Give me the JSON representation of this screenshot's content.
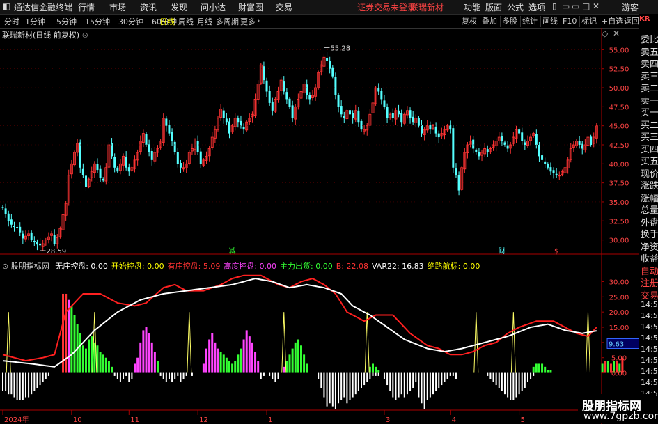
{
  "titlebar": {
    "app_name": "通达信金融终端",
    "menus": [
      "行情",
      "市场",
      "资讯",
      "发现",
      "问小达",
      "财富圈",
      "交易"
    ],
    "notice": "证券交易未登录",
    "stock": "联瑞新材",
    "right_menus": [
      "功能",
      "版面",
      "公式",
      "选项"
    ],
    "user": "游客"
  },
  "toolbar": {
    "periods": [
      "分时",
      "1分钟",
      "5分钟",
      "15分钟",
      "30分钟",
      "60分钟",
      "日线",
      "周线",
      "月线",
      "多周期",
      "更多"
    ],
    "active": "日线",
    "right_buttons": [
      "复权",
      "叠加",
      "多股",
      "统计",
      "画线",
      "F10",
      "标记",
      "+自选",
      "返回"
    ]
  },
  "chart_header": {
    "title": "联瑞新材(日线 前复权)"
  },
  "indicator_header": {
    "name": "股朋指标网",
    "items": [
      {
        "label": "无庄控盘:",
        "value": "0.00",
        "color": "#ffffff"
      },
      {
        "label": "开始控盘:",
        "value": "0.00",
        "color": "#ffff00"
      },
      {
        "label": "有庄控盘:",
        "value": "5.09",
        "color": "#ff3333"
      },
      {
        "label": "高度控盘:",
        "value": "0.00",
        "color": "#ff44ff"
      },
      {
        "label": "主力出货:",
        "value": "0.00",
        "color": "#33ff33"
      },
      {
        "label": "B:",
        "value": "22.08",
        "color": "#ff3333"
      },
      {
        "label": "VAR22:",
        "value": "16.83",
        "color": "#ffffff"
      },
      {
        "label": "绝路航标:",
        "value": "0.00",
        "color": "#ffff00"
      }
    ]
  },
  "chart_data": [
    {
      "type": "candlestick",
      "price_axis_ticks": [
        "55.00",
        "52.50",
        "50.00",
        "47.50",
        "45.00",
        "42.50",
        "40.00",
        "37.50",
        "35.00",
        "32.50",
        "30.00"
      ],
      "ylim": [
        28.5,
        56.5
      ],
      "annotations": {
        "high": "55.28",
        "low": "28.59"
      },
      "event_markers": [
        "减",
        "财",
        "$"
      ],
      "close": [
        34.2,
        33.4,
        32.5,
        32.0,
        31.7,
        31.6,
        31.0,
        30.2,
        30.5,
        30.8,
        30.0,
        29.7,
        29.4,
        29.3,
        29.5,
        30.0,
        30.4,
        30.8,
        29.5,
        30.3,
        31.5,
        33.3,
        34.8,
        38.5,
        40.0,
        41.5,
        42.7,
        39.5,
        38.5,
        37.0,
        38.0,
        39.0,
        40.0,
        39.2,
        38.2,
        37.8,
        39.5,
        42.5,
        41.0,
        39.5,
        39.0,
        40.0,
        41.0,
        39.5,
        39.0,
        39.5,
        40.5,
        41.5,
        43.0,
        44.0,
        42.5,
        41.5,
        40.5,
        41.5,
        42.0,
        43.0,
        46.0,
        45.0,
        44.0,
        43.0,
        41.5,
        40.0,
        39.5,
        39.5,
        40.0,
        41.5,
        42.0,
        43.0,
        41.5,
        40.0,
        40.5,
        41.0,
        42.0,
        43.5,
        44.5,
        46.0,
        47.2,
        46.0,
        45.5,
        44.0,
        45.0,
        46.0,
        45.5,
        45.0,
        44.5,
        45.5,
        46.0,
        46.5,
        48.5,
        50.5,
        53.0,
        51.0,
        49.5,
        48.0,
        47.0,
        48.5,
        49.5,
        51.0,
        49.5,
        48.5,
        47.5,
        46.0,
        47.5,
        48.5,
        49.5,
        50.5,
        49.0,
        48.5,
        49.0,
        50.0,
        52.0,
        53.0,
        54.0,
        53.5,
        52.5,
        51.5,
        49.0,
        47.5,
        46.5,
        46.0,
        47.0,
        46.5,
        46.0,
        47.0,
        45.5,
        44.5,
        44.5,
        45.0,
        46.5,
        48.0,
        50.0,
        49.5,
        48.5,
        47.5,
        46.0,
        46.5,
        46.0,
        47.0,
        46.5,
        45.5,
        46.5,
        47.0,
        46.0,
        45.5,
        46.0,
        45.0,
        44.0,
        44.5,
        45.0,
        44.5,
        45.0,
        44.0,
        43.5,
        44.0,
        44.5,
        45.0,
        44.5,
        39.5,
        38.5,
        36.5,
        39.5,
        41.5,
        42.5,
        43.0,
        42.0,
        41.5,
        41.0,
        41.5,
        42.0,
        41.5,
        42.0,
        42.5,
        43.0,
        43.5,
        43.0,
        42.5,
        42.0,
        42.5,
        43.5,
        44.5,
        44.0,
        43.0,
        42.5,
        43.0,
        43.5,
        44.0,
        42.5,
        41.0,
        40.5,
        40.0,
        39.5,
        39.0,
        38.8,
        38.5,
        38.5,
        39.0,
        39.5,
        40.5,
        42.0,
        42.5,
        43.0,
        42.5,
        42.0,
        42.5,
        43.5,
        42.5,
        43.5,
        45.0
      ]
    },
    {
      "type": "line",
      "indicator_axis_ticks": [
        "30.00",
        "25.00",
        "20.00",
        "15.00",
        "10.00",
        "5.00",
        "0.00"
      ],
      "ylim": [
        -12,
        34
      ],
      "current_value": "9.63",
      "series": [
        {
          "color": "#ff2020",
          "keys": [
            [
              0,
              6
            ],
            [
              8,
              4
            ],
            [
              14,
              5
            ],
            [
              18,
              6
            ],
            [
              22,
              20
            ],
            [
              28,
              26
            ],
            [
              34,
              26
            ],
            [
              40,
              23
            ],
            [
              46,
              22
            ],
            [
              50,
              23
            ],
            [
              56,
              28
            ],
            [
              60,
              29
            ],
            [
              64,
              27
            ],
            [
              70,
              27
            ],
            [
              76,
              29
            ],
            [
              80,
              31
            ],
            [
              84,
              32
            ],
            [
              90,
              32
            ],
            [
              96,
              29
            ],
            [
              100,
              28
            ],
            [
              104,
              30
            ],
            [
              108,
              31
            ],
            [
              112,
              29
            ],
            [
              116,
              26
            ],
            [
              120,
              20
            ],
            [
              126,
              17
            ],
            [
              130,
              19
            ],
            [
              136,
              19
            ],
            [
              142,
              13
            ],
            [
              148,
              9
            ],
            [
              152,
              8
            ],
            [
              156,
              6
            ],
            [
              160,
              6
            ],
            [
              164,
              7
            ],
            [
              168,
              9
            ],
            [
              172,
              10
            ],
            [
              176,
              13
            ],
            [
              180,
              15
            ],
            [
              186,
              17
            ],
            [
              192,
              17
            ],
            [
              196,
              15
            ],
            [
              200,
              13
            ],
            [
              204,
              12
            ],
            [
              208,
              16
            ],
            [
              212,
              19
            ],
            [
              216,
              22
            ]
          ]
        },
        {
          "color": "#ffffff",
          "keys": [
            [
              0,
              4
            ],
            [
              10,
              3
            ],
            [
              18,
              2
            ],
            [
              24,
              6
            ],
            [
              32,
              14
            ],
            [
              40,
              20
            ],
            [
              48,
              24
            ],
            [
              56,
              26
            ],
            [
              64,
              27
            ],
            [
              72,
              28
            ],
            [
              80,
              29
            ],
            [
              88,
              31
            ],
            [
              94,
              30
            ],
            [
              100,
              28
            ],
            [
              106,
              29
            ],
            [
              112,
              28
            ],
            [
              118,
              26
            ],
            [
              122,
              22
            ],
            [
              128,
              19
            ],
            [
              134,
              15
            ],
            [
              140,
              11
            ],
            [
              148,
              8
            ],
            [
              154,
              7
            ],
            [
              160,
              8
            ],
            [
              168,
              10
            ],
            [
              176,
              12
            ],
            [
              184,
              15
            ],
            [
              190,
              16
            ],
            [
              196,
              14
            ],
            [
              202,
              13
            ],
            [
              208,
              14
            ],
            [
              214,
              16
            ],
            [
              218,
              17
            ]
          ]
        }
      ],
      "histogram_pos": [
        0,
        0,
        0,
        0,
        0,
        0,
        0,
        0,
        0,
        0,
        0,
        0,
        0,
        0,
        0,
        0,
        0,
        0,
        0,
        0,
        0,
        26,
        26,
        24,
        22,
        19,
        16,
        13,
        9,
        8,
        11,
        12,
        10,
        9,
        7,
        6,
        5,
        4,
        2,
        0,
        0,
        0,
        0,
        0,
        0,
        0,
        3,
        5,
        10,
        14,
        15,
        13,
        10,
        7,
        4,
        0,
        0,
        0,
        0,
        0,
        0,
        0,
        0,
        0,
        0,
        0,
        0,
        0,
        0,
        0,
        3,
        8,
        11,
        13,
        10,
        8,
        7,
        6,
        5,
        4,
        3,
        4,
        6,
        8,
        11,
        14,
        12,
        10,
        7,
        4,
        0,
        0,
        0,
        0,
        0,
        0,
        0,
        0,
        2,
        4,
        6,
        8,
        10,
        11,
        9,
        6,
        3,
        0,
        0,
        0,
        0,
        0,
        0,
        0,
        0,
        0,
        0,
        0,
        0,
        0,
        0,
        0,
        0,
        0,
        0,
        0,
        0,
        0,
        2,
        3,
        2,
        1,
        0,
        0,
        0,
        0,
        0,
        0,
        0,
        0,
        0,
        0,
        0,
        0,
        0,
        0,
        0,
        0,
        0,
        0,
        0,
        0,
        0,
        0,
        0,
        0,
        0,
        0,
        0,
        0,
        0,
        0,
        0,
        0,
        0,
        0,
        0,
        0,
        0,
        0,
        0,
        0,
        0,
        0,
        0,
        0,
        0,
        0,
        0,
        0,
        0,
        0,
        0,
        0,
        0,
        2,
        3,
        3,
        3,
        2,
        1,
        1,
        0,
        0,
        0,
        0,
        0,
        0,
        0,
        0,
        0,
        0,
        0,
        0,
        0,
        0,
        0,
        0,
        0,
        3,
        4,
        4,
        3,
        4,
        4,
        3,
        5
      ],
      "histogram_neg": [
        -6,
        -6,
        -7,
        -7,
        -8,
        -9,
        -9,
        -9,
        -8,
        -8,
        -7,
        -6,
        -5,
        -4,
        -3,
        -2,
        -1,
        0,
        0,
        0,
        0,
        0,
        0,
        0,
        0,
        0,
        0,
        0,
        0,
        0,
        0,
        0,
        0,
        0,
        0,
        0,
        0,
        0,
        0,
        -1,
        -2,
        -3,
        -2,
        -1,
        -3,
        -2,
        0,
        0,
        0,
        0,
        0,
        0,
        0,
        0,
        0,
        -1,
        -2,
        -3,
        -2,
        -3,
        -2,
        -1,
        -3,
        -2,
        -1,
        0,
        -1,
        0,
        0,
        0,
        0,
        0,
        0,
        0,
        0,
        0,
        0,
        0,
        0,
        0,
        0,
        0,
        0,
        0,
        0,
        0,
        0,
        0,
        0,
        0,
        -2,
        -1,
        0,
        -1,
        -2,
        -3,
        -2,
        0,
        0,
        0,
        0,
        0,
        0,
        0,
        0,
        0,
        0,
        0,
        0,
        0,
        -2,
        -5,
        -8,
        -11,
        -10,
        -11,
        -12,
        -10,
        -9,
        -8,
        -10,
        -9,
        -8,
        -7,
        -6,
        -5,
        -4,
        -3,
        -2,
        -1,
        -1,
        -1,
        0,
        -2,
        -4,
        -6,
        -8,
        -9,
        -8,
        -7,
        -8,
        -7,
        -6,
        -5,
        -3,
        -8,
        -10,
        -12,
        -9,
        -8,
        -7,
        -6,
        -5,
        -4,
        -3,
        -2,
        -1,
        -1,
        -2,
        0,
        0,
        0,
        0,
        0,
        0,
        0,
        0,
        0,
        0,
        -1,
        -2,
        -3,
        -4,
        -5,
        -6,
        -7,
        -8,
        -9,
        -9,
        -8,
        -7,
        -6,
        -5,
        -3,
        -2,
        -1,
        0,
        0,
        0,
        0,
        0,
        0,
        0,
        0,
        0,
        0,
        0,
        0,
        0,
        0,
        0,
        0,
        0,
        0,
        0,
        0,
        0,
        0,
        0,
        0,
        0,
        0,
        0,
        0,
        0,
        0
      ],
      "spike_positions": [
        2,
        32,
        65,
        98,
        127,
        165,
        178,
        204
      ]
    }
  ],
  "x_axis_ticks": [
    {
      "idx": 0,
      "label": "2024年"
    },
    {
      "idx": 24,
      "label": "10"
    },
    {
      "idx": 44,
      "label": "11"
    },
    {
      "idx": 68,
      "label": "12"
    },
    {
      "idx": 92,
      "label": "1"
    },
    {
      "idx": 133,
      "label": "3"
    },
    {
      "idx": 156,
      "label": "4"
    },
    {
      "idx": 180,
      "label": "5"
    },
    {
      "idx": 202,
      "label": "6"
    }
  ],
  "right_panel": {
    "top_label": "KR",
    "items": [
      "委比",
      "卖五",
      "卖四",
      "卖三",
      "卖二",
      "卖一",
      "买一",
      "买二",
      "买三",
      "买四",
      "买五",
      "现价",
      "涨跌",
      "涨幅",
      "总量",
      "外盘",
      "换手",
      "净资",
      "收益",
      "自动",
      "注册",
      "交易",
      "14:56",
      "14:56",
      "14:56",
      "14:56",
      "14:56",
      "14:56",
      "14:56",
      "14:56",
      "14:56"
    ]
  },
  "watermark": {
    "line1": "股朋指标网",
    "line2": "www.7gpzb.com"
  },
  "colors": {
    "up": "#ff3333",
    "down": "#54ffff",
    "axis": "#aa0000",
    "grid": "#5a0000"
  }
}
